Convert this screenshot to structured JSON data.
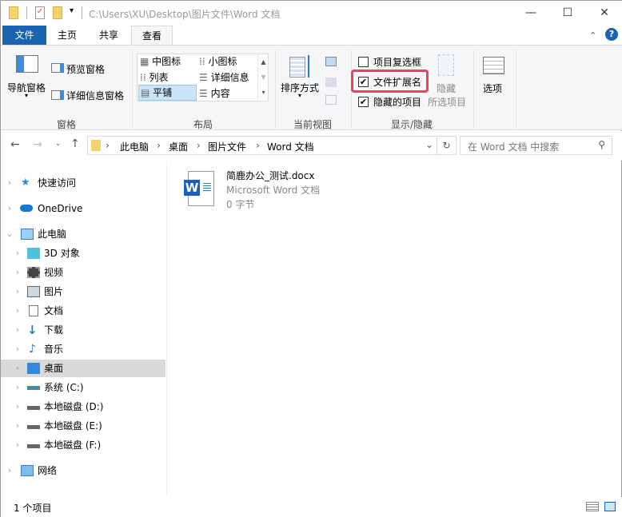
{
  "window": {
    "path": "C:\\Users\\XU\\Desktop\\图片文件\\Word 文档"
  },
  "tabs": [
    "文件",
    "主页",
    "共享",
    "查看"
  ],
  "ribbon": {
    "panes": {
      "nav_pane": "导航窗格",
      "preview": "预览窗格",
      "details": "详细信息窗格",
      "label": "窗格"
    },
    "layout": {
      "items": [
        "中图标",
        "小图标",
        "列表",
        "详细信息",
        "平铺",
        "内容"
      ],
      "label": "布局"
    },
    "current_view": {
      "sort": "排序方式",
      "label": "当前视图"
    },
    "show_hide": {
      "item_checkboxes": "项目复选框",
      "file_extensions": "文件扩展名",
      "hidden_items": "隐藏的项目",
      "hide_selected_1": "隐藏",
      "hide_selected_2": "所选项目",
      "label": "显示/隐藏",
      "checked": {
        "item_checkboxes": false,
        "file_extensions": true,
        "hidden_items": true
      }
    },
    "options": "选项",
    "highlight_color": "#e8445a"
  },
  "address": {
    "crumbs": [
      "此电脑",
      "桌面",
      "图片文件",
      "Word 文档"
    ],
    "search_placeholder": "在 Word 文档 中搜索"
  },
  "nav": [
    {
      "label": "快速访问"
    },
    {
      "label": "OneDrive"
    },
    {
      "label": "此电脑"
    },
    {
      "label": "3D 对象"
    },
    {
      "label": "视频"
    },
    {
      "label": "图片"
    },
    {
      "label": "文档"
    },
    {
      "label": "下载"
    },
    {
      "label": "音乐"
    },
    {
      "label": "桌面"
    },
    {
      "label": "系统 (C:)"
    },
    {
      "label": "本地磁盘 (D:)"
    },
    {
      "label": "本地磁盘 (E:)"
    },
    {
      "label": "本地磁盘 (F:)"
    },
    {
      "label": "网络"
    }
  ],
  "file": {
    "name": "简鹿办公_测试.docx",
    "type": "Microsoft Word 文档",
    "size": "0 字节"
  },
  "status": {
    "count": "1 个项目"
  }
}
